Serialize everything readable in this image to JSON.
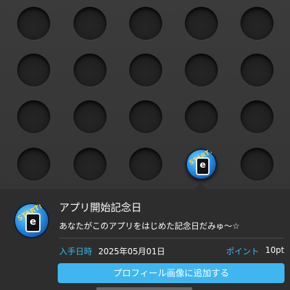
{
  "badges_grid": {
    "rows": 4,
    "cols": 5,
    "earned": [
      {
        "row": 3,
        "col": 3,
        "icon": "start-e-badge-icon",
        "text": "START!"
      }
    ]
  },
  "detail": {
    "icon": "start-e-badge-icon",
    "icon_text": "START!",
    "title": "アプリ開始記念日",
    "description": "あなたがこのアプリをはじめた記念日だみゅ〜☆",
    "date_label": "入手日時",
    "date_value": "2025年05月01日",
    "points_label": "ポイント",
    "points_value": "10pt",
    "add_button_label": "プロフィール画像に追加する"
  },
  "colors": {
    "accent": "#3fb6f0",
    "background": "#3a3a3a",
    "panel": "#2d2d2d"
  }
}
